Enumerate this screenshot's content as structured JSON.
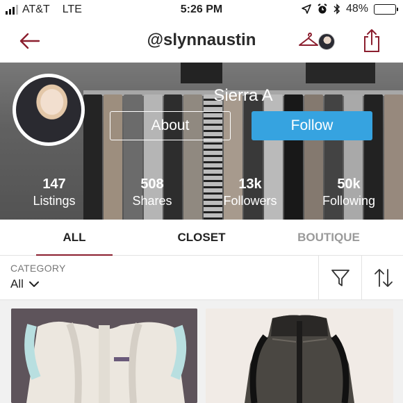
{
  "status_bar": {
    "carrier": "AT&T",
    "network": "LTE",
    "time": "5:26 PM",
    "battery": "48%",
    "battery_level": 0.48
  },
  "nav": {
    "back_icon": "back-arrow-icon",
    "title": "@slynnaustin",
    "hanger_icon": "hanger-icon",
    "share_icon": "share-icon"
  },
  "profile": {
    "name": "Sierra A",
    "about_label": "About",
    "follow_label": "Follow",
    "stats": [
      {
        "value": "147",
        "label": "Listings"
      },
      {
        "value": "508",
        "label": "Shares"
      },
      {
        "value": "13k",
        "label": "Followers"
      },
      {
        "value": "50k",
        "label": "Following"
      }
    ]
  },
  "tabs": [
    {
      "label": "ALL",
      "active": true
    },
    {
      "label": "CLOSET",
      "active": false
    },
    {
      "label": "BOUTIQUE",
      "active": false
    }
  ],
  "filter": {
    "category_label": "CATEGORY",
    "category_value": "All",
    "filter_icon": "funnel-icon",
    "sort_icon": "sort-icon"
  },
  "colors": {
    "accent": "#8b1e2e",
    "follow_blue": "#36a3e0"
  }
}
